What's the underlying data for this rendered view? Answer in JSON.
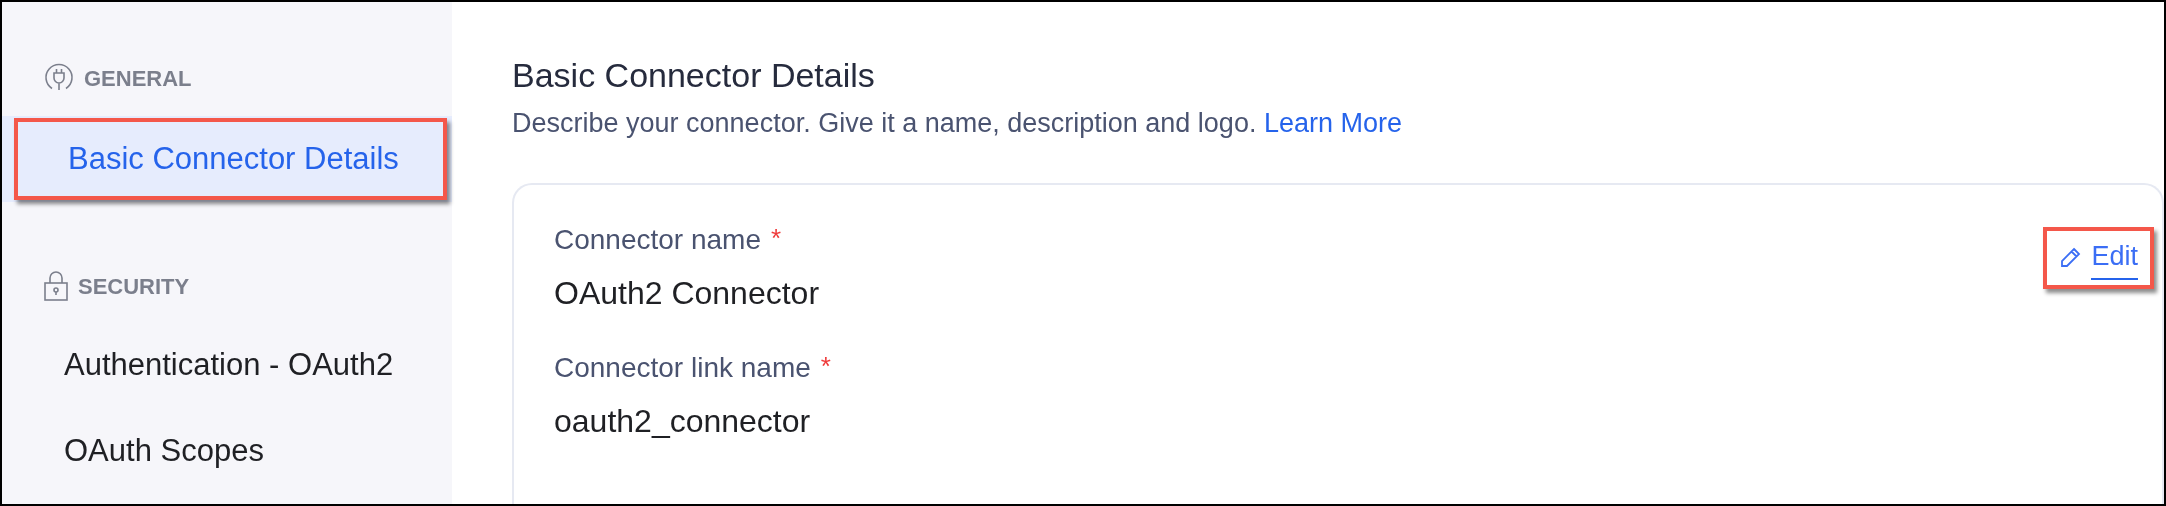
{
  "sidebar": {
    "sections": [
      {
        "kind": "plug",
        "title": "GENERAL",
        "items": [
          {
            "label": "Basic Connector Details",
            "selected": true,
            "highlighted": true
          }
        ]
      },
      {
        "kind": "lock",
        "title": "SECURITY",
        "items": [
          {
            "label": "Authentication - OAuth2",
            "selected": false,
            "highlighted": false
          },
          {
            "label": "OAuth Scopes",
            "selected": false,
            "highlighted": false
          }
        ]
      }
    ]
  },
  "main": {
    "title": "Basic Connector Details",
    "description": "Describe your connector. Give it a name, description and logo.",
    "link": "Learn More",
    "card": {
      "edit": {
        "label": "Edit",
        "highlighted": true
      },
      "fields": [
        {
          "label": "Connector name",
          "required": true,
          "required_mark": "*",
          "value": "OAuth2 Connector"
        },
        {
          "label": "Connector link name",
          "required": true,
          "required_mark": "*",
          "value": "oauth2_connector"
        }
      ]
    }
  }
}
